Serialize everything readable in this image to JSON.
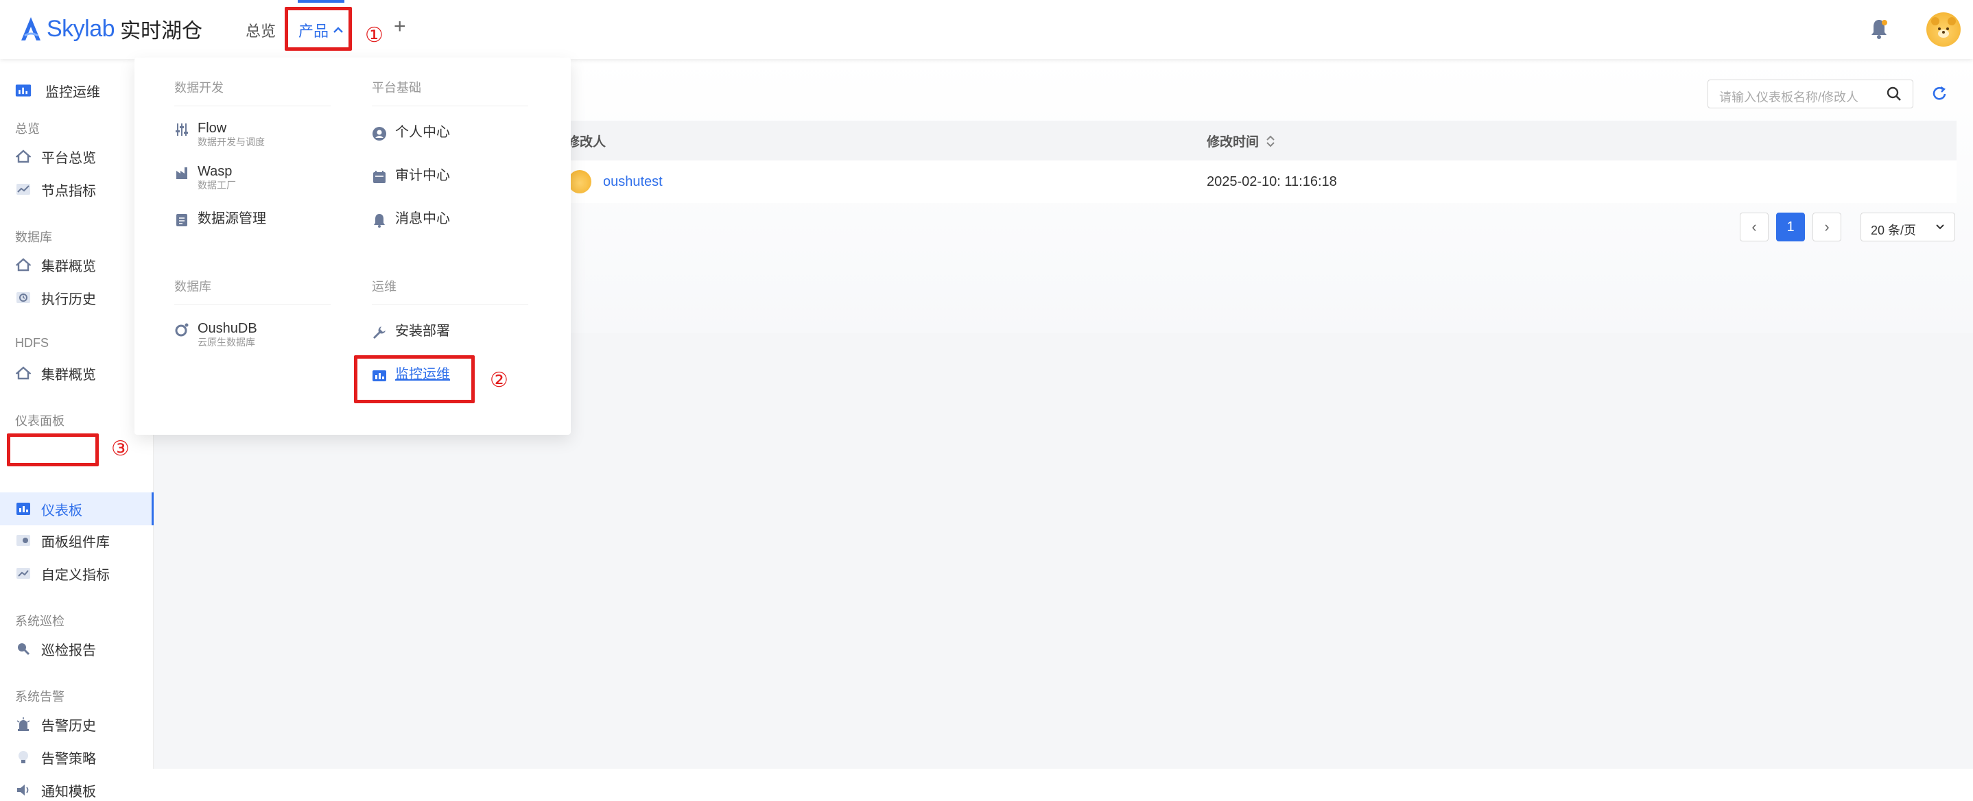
{
  "header": {
    "logo_text": "Skylab",
    "logo_cn": "实时湖仓",
    "nav_overview": "总览",
    "nav_product": "产品",
    "nav_plus": "+"
  },
  "annotations": {
    "n1": "①",
    "n2": "②",
    "n3": "③"
  },
  "dropdown": {
    "sections": {
      "dev": "数据开发",
      "platform": "平台基础",
      "db": "数据库",
      "ops": "运维"
    },
    "items": {
      "flow_title": "Flow",
      "flow_sub": "数据开发与调度",
      "wasp_title": "Wasp",
      "wasp_sub": "数据工厂",
      "datasource": "数据源管理",
      "personal": "个人中心",
      "audit": "审计中心",
      "message": "消息中心",
      "oushu_title": "OushuDB",
      "oushu_sub": "云原生数据库",
      "install": "安装部署",
      "monitor": "监控运维"
    }
  },
  "sidebar": {
    "top_title": "监控运维",
    "groups": {
      "overview": "总览",
      "database": "数据库",
      "hdfs": "HDFS",
      "dashboard": "仪表面板",
      "inspection": "系统巡检",
      "alert": "系统告警"
    },
    "items": {
      "platform_overview": "平台总览",
      "node_metrics": "节点指标",
      "db_cluster": "集群概览",
      "exec_history": "执行历史",
      "hdfs_cluster": "集群概览",
      "dashboard": "仪表板",
      "panel_lib": "面板组件库",
      "custom_metrics": "自定义指标",
      "inspection_report": "巡检报告",
      "alert_history": "告警历史",
      "alert_policy": "告警策略",
      "notify_template": "通知模板"
    }
  },
  "main": {
    "search_placeholder": "请输入仪表板名称/修改人",
    "columns": {
      "modifier": "修改人",
      "modified_time": "修改时间"
    },
    "rows": [
      {
        "modifier": "oushutest",
        "modified_time": "2025-02-10: 11:16:18"
      }
    ],
    "pager": {
      "prev": "‹",
      "current": "1",
      "next": "›",
      "page_size": "20 条/页"
    }
  },
  "colors": {
    "accent": "#2f6fea",
    "annotation": "#e31d1d"
  }
}
